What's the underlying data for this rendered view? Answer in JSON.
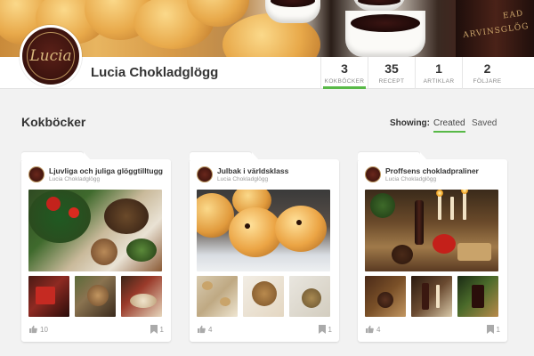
{
  "profile": {
    "name": "Lucia Chokladglögg",
    "logo_text": "Lucia"
  },
  "stats": [
    {
      "value": "3",
      "label": "KOKBÖCKER",
      "active": true
    },
    {
      "value": "35",
      "label": "RECEPT",
      "active": false
    },
    {
      "value": "1",
      "label": "ARTIKLAR",
      "active": false
    },
    {
      "value": "2",
      "label": "FÖLJARE",
      "active": false
    }
  ],
  "section": {
    "title": "Kokböcker",
    "showing_label": "Showing:",
    "created_label": "Created",
    "saved_label": "Saved"
  },
  "cards": [
    {
      "title": "Ljuvliga och juliga glöggtilltugg",
      "author": "Lucia Chokladglögg",
      "likes": "10",
      "saves": "1"
    },
    {
      "title": "Julbak i världsklass",
      "author": "Lucia Chokladglögg",
      "likes": "4",
      "saves": "1"
    },
    {
      "title": "Proffsens chokladpraliner",
      "author": "Lucia Chokladglögg",
      "likes": "4",
      "saves": "1"
    }
  ],
  "icons": {
    "like": "thumbs-up-icon",
    "save": "bookmark-icon"
  },
  "colors": {
    "accent": "#58b947",
    "brand": "#3b130e"
  }
}
